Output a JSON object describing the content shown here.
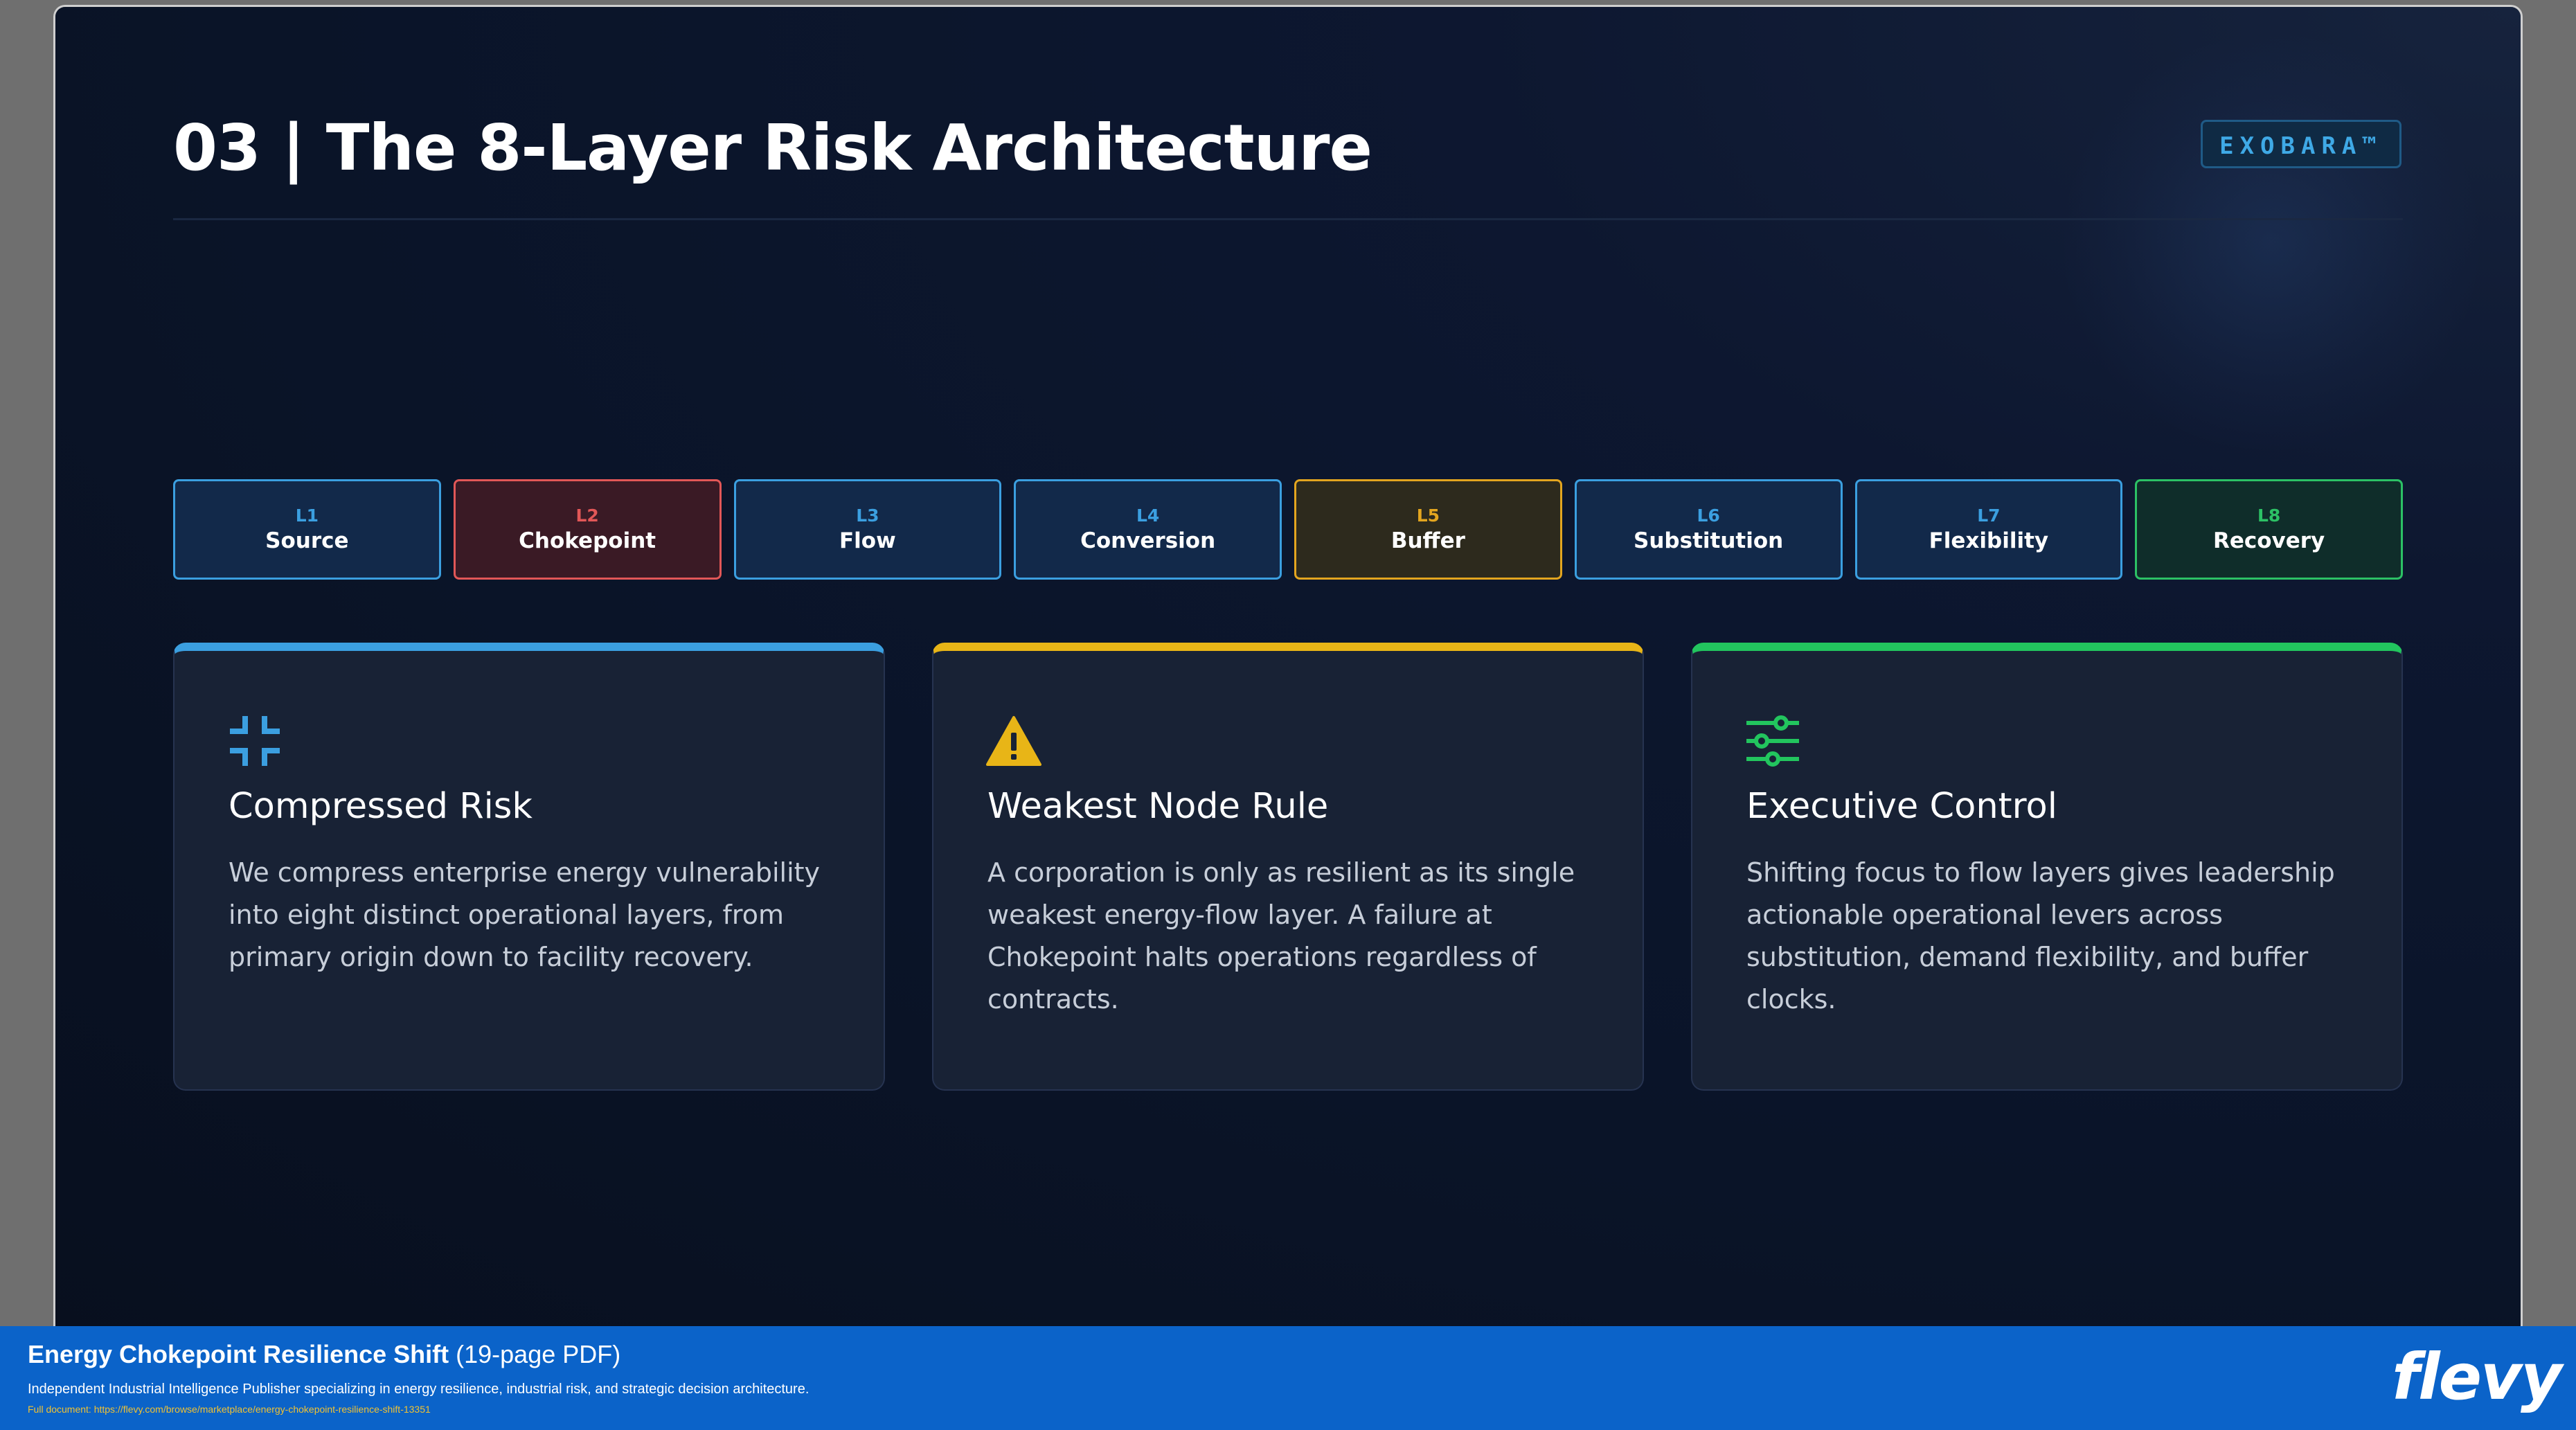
{
  "slide": {
    "title": "03 | The 8-Layer Risk Architecture",
    "brand": "EXOBARA™",
    "layers": [
      {
        "code": "L1",
        "name": "Source",
        "accent": "#3b9fe0",
        "bg": "#12294a"
      },
      {
        "code": "L2",
        "name": "Chokepoint",
        "accent": "#e25757",
        "bg": "#3a1a25"
      },
      {
        "code": "L3",
        "name": "Flow",
        "accent": "#3b9fe0",
        "bg": "#12294a"
      },
      {
        "code": "L4",
        "name": "Conversion",
        "accent": "#3b9fe0",
        "bg": "#12294a"
      },
      {
        "code": "L5",
        "name": "Buffer",
        "accent": "#e3a51f",
        "bg": "#2d2a1d"
      },
      {
        "code": "L6",
        "name": "Substitution",
        "accent": "#3b9fe0",
        "bg": "#12294a"
      },
      {
        "code": "L7",
        "name": "Flexibility",
        "accent": "#3b9fe0",
        "bg": "#12294a"
      },
      {
        "code": "L8",
        "name": "Recovery",
        "accent": "#2cc165",
        "bg": "#0f2d2a"
      }
    ],
    "cards": [
      {
        "icon": "compress-icon",
        "accent": "#3b9fe0",
        "title": "Compressed Risk",
        "body": "We compress enterprise energy vulnerability into eight distinct operational layers, from primary origin down to facility recovery."
      },
      {
        "icon": "warning-icon",
        "accent": "#e8b517",
        "title": "Weakest Node Rule",
        "body": "A corporation is only as resilient as its single weakest energy-flow layer. A failure at Chokepoint halts operations regardless of contracts."
      },
      {
        "icon": "sliders-icon",
        "accent": "#22c55e",
        "title": "Executive Control",
        "body": "Shifting focus to flow layers gives leadership actionable operational levers across substitution, demand flexibility, and buffer clocks."
      }
    ]
  },
  "footer": {
    "doc_title": "Energy Chokepoint Resilience Shift",
    "doc_pages": "(19-page PDF)",
    "publisher": "Independent Industrial Intelligence Publisher specializing in energy resilience, industrial risk, and strategic decision architecture.",
    "full_document": "Full document: https://flevy.com/browse/marketplace/energy-chokepoint-resilience-shift-13351",
    "logo": "flevy",
    "background": "#0b63c9"
  }
}
